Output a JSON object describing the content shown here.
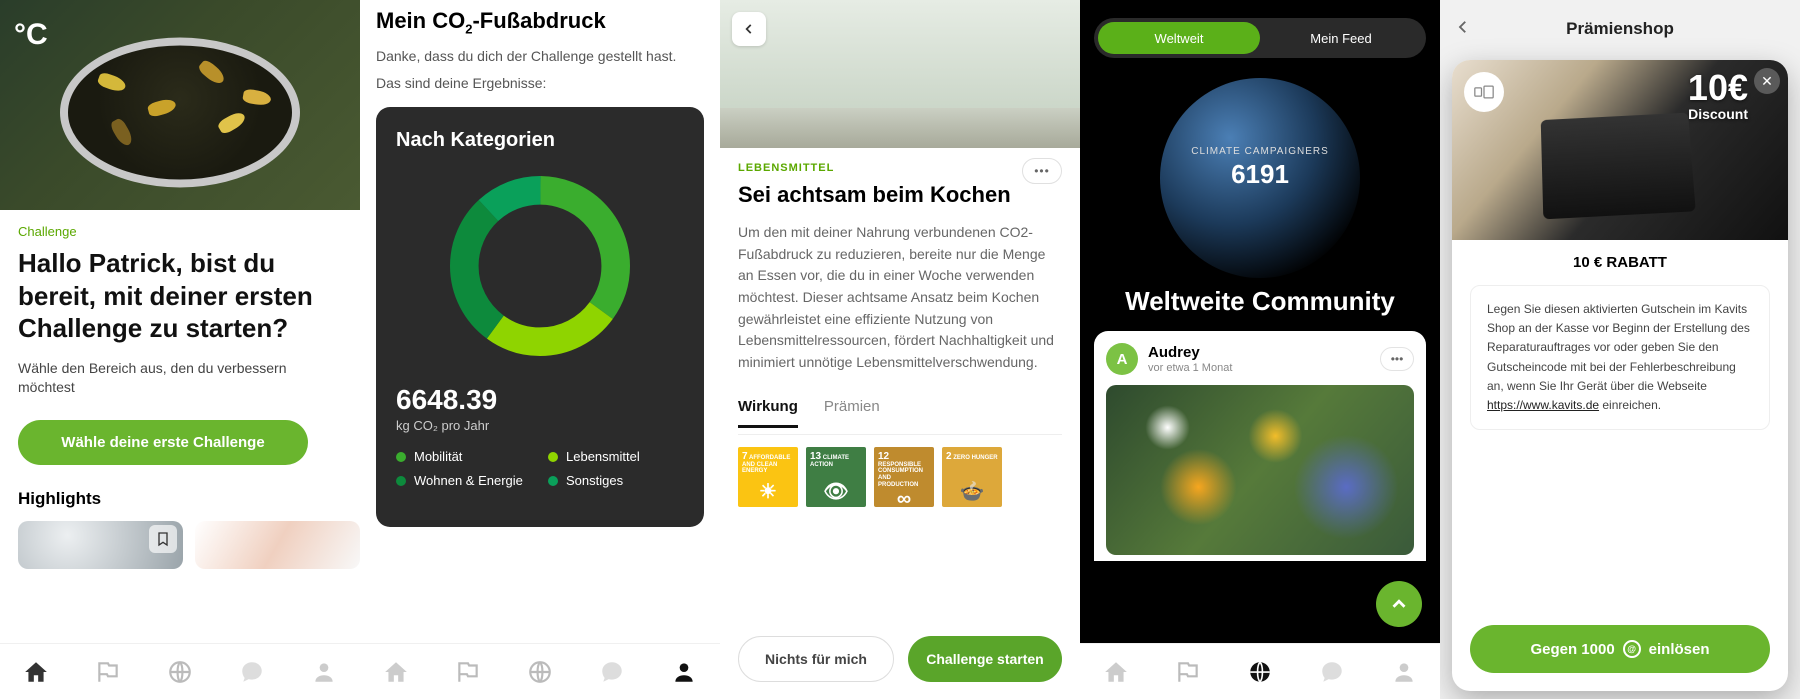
{
  "screen1": {
    "logo": "°C",
    "eyebrow": "Challenge",
    "title": "Hallo Patrick, bist du bereit, mit deiner ersten Challenge zu starten?",
    "subtitle": "Wähle den Bereich aus, den du verbessern möchtest",
    "cta": "Wähle deine erste Challenge",
    "highlights": "Highlights"
  },
  "screen2": {
    "title": "Mein CO₂-Fußabdruck",
    "line1": "Danke, dass du dich der Challenge gestellt hast.",
    "line2": "Das sind deine Ergebnisse:",
    "card_title": "Nach Kategorien",
    "total_value": "6648.39",
    "total_unit": "kg CO₂ pro Jahr",
    "legend": [
      {
        "label": "Mobilität",
        "color": "#3aad2e"
      },
      {
        "label": "Lebensmittel",
        "color": "#8fd400"
      },
      {
        "label": "Wohnen & Energie",
        "color": "#0d8a3c"
      },
      {
        "label": "Sonstiges",
        "color": "#0aa05a"
      }
    ]
  },
  "chart_data": {
    "type": "pie",
    "title": "Nach Kategorien",
    "total": 6648.39,
    "unit": "kg CO₂ pro Jahr",
    "series": [
      {
        "name": "Mobilität",
        "value": 35,
        "color": "#3aad2e"
      },
      {
        "name": "Lebensmittel",
        "value": 25,
        "color": "#8fd400"
      },
      {
        "name": "Wohnen & Energie",
        "value": 28,
        "color": "#0d8a3c"
      },
      {
        "name": "Sonstiges",
        "value": 12,
        "color": "#0aa05a"
      }
    ]
  },
  "screen3": {
    "eyebrow": "LEBENSMITTEL",
    "title": "Sei achtsam beim Kochen",
    "desc": "Um den mit deiner Nahrung verbundenen CO2-Fußabdruck zu reduzieren, bereite nur die Menge an Essen vor, die du in einer Woche verwenden möchtest. Dieser achtsame Ansatz beim Kochen gewährleistet eine effiziente Nutzung von Lebensmittelressourcen, fördert Nachhaltigkeit und minimiert unnötige Lebensmittelverschwendung.",
    "tabs": {
      "active": "Wirkung",
      "other": "Prämien"
    },
    "sdg": [
      {
        "num": "7",
        "label": "AFFORDABLE AND CLEAN ENERGY",
        "color": "#fbc412",
        "icon": "☀"
      },
      {
        "num": "13",
        "label": "CLIMATE ACTION",
        "color": "#3f7e44",
        "icon": "👁"
      },
      {
        "num": "12",
        "label": "RESPONSIBLE CONSUMPTION AND PRODUCTION",
        "color": "#bf8b2e",
        "icon": "∞"
      },
      {
        "num": "2",
        "label": "ZERO HUNGER",
        "color": "#dda83a",
        "icon": "🍲"
      }
    ],
    "btn_ghost": "Nichts für mich",
    "btn_solid": "Challenge starten"
  },
  "screen4": {
    "tabs": {
      "left": "Weltweit",
      "right": "Mein Feed"
    },
    "label": "CLIMATE CAMPAIGNERS",
    "count": "6191",
    "headline": "Weltweite Community",
    "post": {
      "avatar": "A",
      "name": "Audrey",
      "time": "vor etwa 1 Monat"
    }
  },
  "screen5": {
    "header": "Prämienshop",
    "discount_big": "10€",
    "discount_small": "Discount",
    "title": "10 € RABATT",
    "body": "Legen Sie diesen aktivierten Gutschein im Kavits Shop an der Kasse vor Beginn der Erstellung des Reparaturauftrages vor oder geben Sie den Gutscheincode mit bei der Fehlerbeschreibung an, wenn Sie Ihr Gerät über die Webseite ",
    "link": "https://www.kavits.de",
    "body_end": " einreichen.",
    "cta_pre": "Gegen 1000",
    "cta_post": "einlösen",
    "bg_title": "10 € RABATT",
    "bg_line": "Legen Sie diesen aktivierten Gutschein im"
  },
  "nav": {
    "home": "home-icon",
    "flag": "flag-icon",
    "globe": "globe-icon",
    "chat": "chat-icon",
    "profile": "profile-icon"
  }
}
